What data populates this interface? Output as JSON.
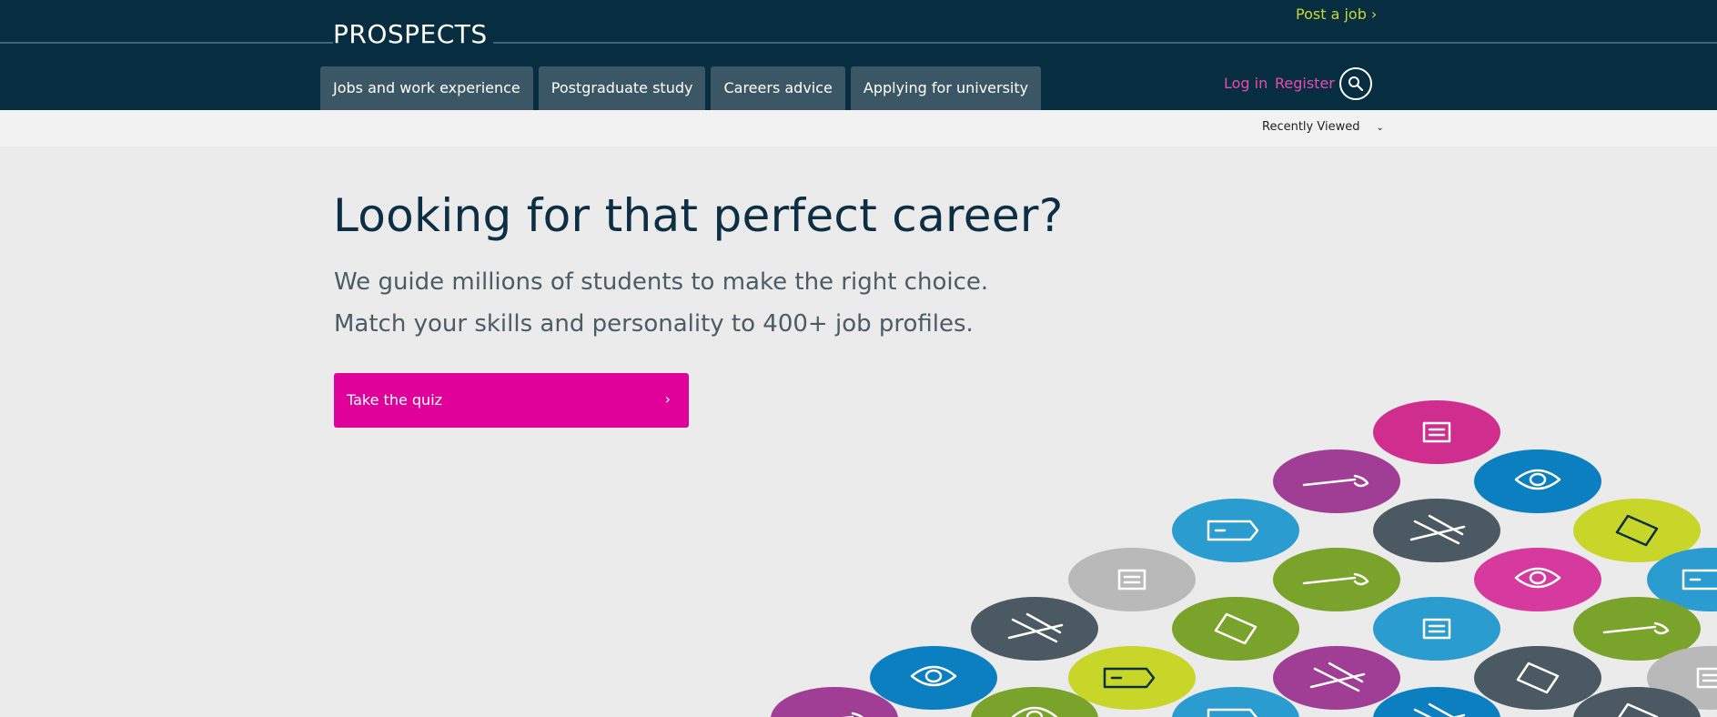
{
  "header": {
    "logo_text": "PROSPECTS",
    "post_job": "Post a job ›",
    "nav_tabs": [
      {
        "label": "Jobs and work experience"
      },
      {
        "label": "Postgraduate study"
      },
      {
        "label": "Careers advice"
      },
      {
        "label": "Applying for university"
      }
    ],
    "login": "Log in",
    "register": "Register",
    "search_icon": "search-icon"
  },
  "subbar": {
    "recently_viewed": "Recently Viewed",
    "chevron": "⌄"
  },
  "hero": {
    "title": "Looking for that perfect career?",
    "line1": "We guide millions of students to make the right choice.",
    "line2": "Match your skills and personality to 400+ job profiles.",
    "cta_label": "Take the quiz",
    "cta_arrow": "›"
  },
  "illustration": {
    "icons": [
      "document-icon",
      "sword-icon",
      "camera-icon",
      "tag-icon",
      "books-icon",
      "first-aid-icon",
      "mountain-icon",
      "laptop-icon",
      "broom-icon",
      "water-drop-icon",
      "plane-icon",
      "megaphone-icon",
      "piggy-bank-icon",
      "car-icon",
      "umbrella-icon",
      "tree-icon",
      "pen-icon",
      "tool-icon"
    ]
  },
  "colors": {
    "navy": "#072d40",
    "magenta": "#e0009a",
    "pink_text": "#ea4bb3",
    "lime": "#c9d837"
  }
}
